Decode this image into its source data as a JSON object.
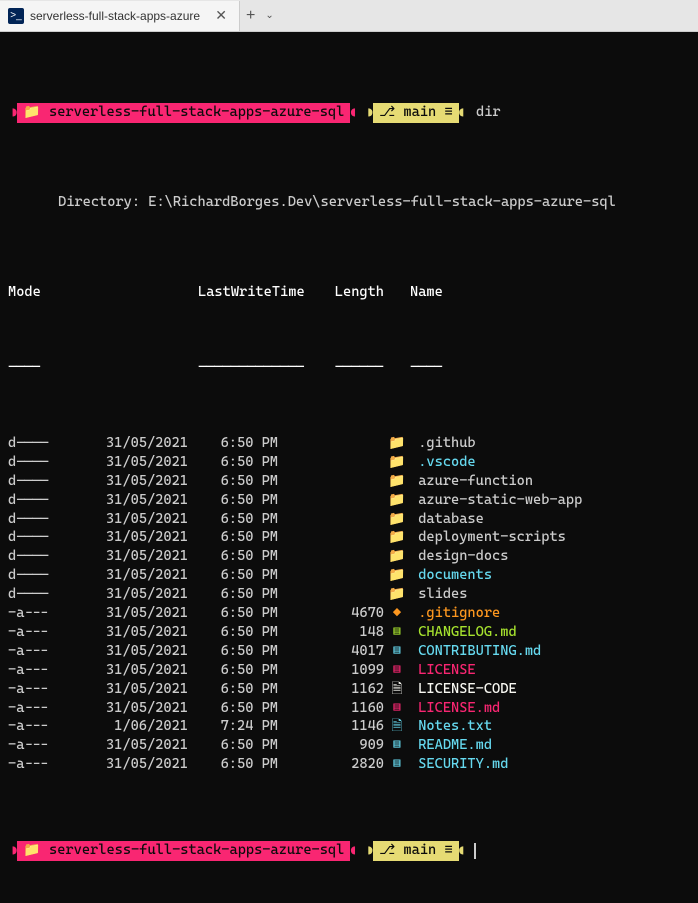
{
  "tab": {
    "title": "serverless-full-stack-apps-azure"
  },
  "prompt": {
    "path": "serverless-full-stack-apps-azure-sql",
    "branch": "main",
    "cmd": "dir"
  },
  "directory_line": "Directory: E:\\RichardBorges.Dev\\serverless-full-stack-apps-azure-sql",
  "headers": {
    "mode": "Mode",
    "lwt": "LastWriteTime",
    "length": "Length",
    "name": "Name"
  },
  "dashes": {
    "mode": "----",
    "lwt": "-------------",
    "length": "------",
    "name": "----"
  },
  "rows": [
    {
      "mode": "d----",
      "date": "31/05/2021",
      "time": "6:50 PM",
      "length": "",
      "icon": "📁",
      "iconClass": "folder-ico",
      "name": ".github",
      "nameClass": "dim"
    },
    {
      "mode": "d----",
      "date": "31/05/2021",
      "time": "6:50 PM",
      "length": "",
      "icon": "📁",
      "iconClass": "folder-ico-blue",
      "name": ".vscode",
      "nameClass": "cyan"
    },
    {
      "mode": "d----",
      "date": "31/05/2021",
      "time": "6:50 PM",
      "length": "",
      "icon": "📁",
      "iconClass": "folder-ico",
      "name": "azure-function",
      "nameClass": "dim"
    },
    {
      "mode": "d----",
      "date": "31/05/2021",
      "time": "6:50 PM",
      "length": "",
      "icon": "📁",
      "iconClass": "folder-ico",
      "name": "azure-static-web-app",
      "nameClass": "dim"
    },
    {
      "mode": "d----",
      "date": "31/05/2021",
      "time": "6:50 PM",
      "length": "",
      "icon": "📁",
      "iconClass": "folder-ico",
      "name": "database",
      "nameClass": "dim"
    },
    {
      "mode": "d----",
      "date": "31/05/2021",
      "time": "6:50 PM",
      "length": "",
      "icon": "📁",
      "iconClass": "folder-ico",
      "name": "deployment-scripts",
      "nameClass": "dim"
    },
    {
      "mode": "d----",
      "date": "31/05/2021",
      "time": "6:50 PM",
      "length": "",
      "icon": "📁",
      "iconClass": "folder-ico",
      "name": "design-docs",
      "nameClass": "dim"
    },
    {
      "mode": "d----",
      "date": "31/05/2021",
      "time": "6:50 PM",
      "length": "",
      "icon": "📁",
      "iconClass": "folder-ico-blue",
      "name": "documents",
      "nameClass": "cyan"
    },
    {
      "mode": "d----",
      "date": "31/05/2021",
      "time": "6:50 PM",
      "length": "",
      "icon": "📁",
      "iconClass": "folder-ico",
      "name": "slides",
      "nameClass": "dim"
    },
    {
      "mode": "-a---",
      "date": "31/05/2021",
      "time": "6:50 PM",
      "length": "4670",
      "icon": "◆",
      "iconClass": "orange",
      "name": ".gitignore",
      "nameClass": "orange"
    },
    {
      "mode": "-a---",
      "date": "31/05/2021",
      "time": "6:50 PM",
      "length": "148",
      "icon": "▤",
      "iconClass": "green",
      "name": "CHANGELOG.md",
      "nameClass": "green"
    },
    {
      "mode": "-a---",
      "date": "31/05/2021",
      "time": "6:50 PM",
      "length": "4017",
      "icon": "▤",
      "iconClass": "cyan",
      "name": "CONTRIBUTING.md",
      "nameClass": "cyan"
    },
    {
      "mode": "-a---",
      "date": "31/05/2021",
      "time": "6:50 PM",
      "length": "1099",
      "icon": "▤",
      "iconClass": "red",
      "name": "LICENSE",
      "nameClass": "red"
    },
    {
      "mode": "-a---",
      "date": "31/05/2021",
      "time": "6:50 PM",
      "length": "1162",
      "icon": "🗎",
      "iconClass": "white",
      "name": "LICENSE-CODE",
      "nameClass": "white"
    },
    {
      "mode": "-a---",
      "date": "31/05/2021",
      "time": "6:50 PM",
      "length": "1160",
      "icon": "▤",
      "iconClass": "red",
      "name": "LICENSE.md",
      "nameClass": "red"
    },
    {
      "mode": "-a---",
      "date": "1/06/2021",
      "time": "7:24 PM",
      "length": "1146",
      "icon": "🗎",
      "iconClass": "cyan",
      "name": "Notes.txt",
      "nameClass": "cyan"
    },
    {
      "mode": "-a---",
      "date": "31/05/2021",
      "time": "6:50 PM",
      "length": "909",
      "icon": "▤",
      "iconClass": "cyan",
      "name": "README.md",
      "nameClass": "cyan"
    },
    {
      "mode": "-a---",
      "date": "31/05/2021",
      "time": "6:50 PM",
      "length": "2820",
      "icon": "▤",
      "iconClass": "cyan",
      "name": "SECURITY.md",
      "nameClass": "cyan"
    }
  ]
}
